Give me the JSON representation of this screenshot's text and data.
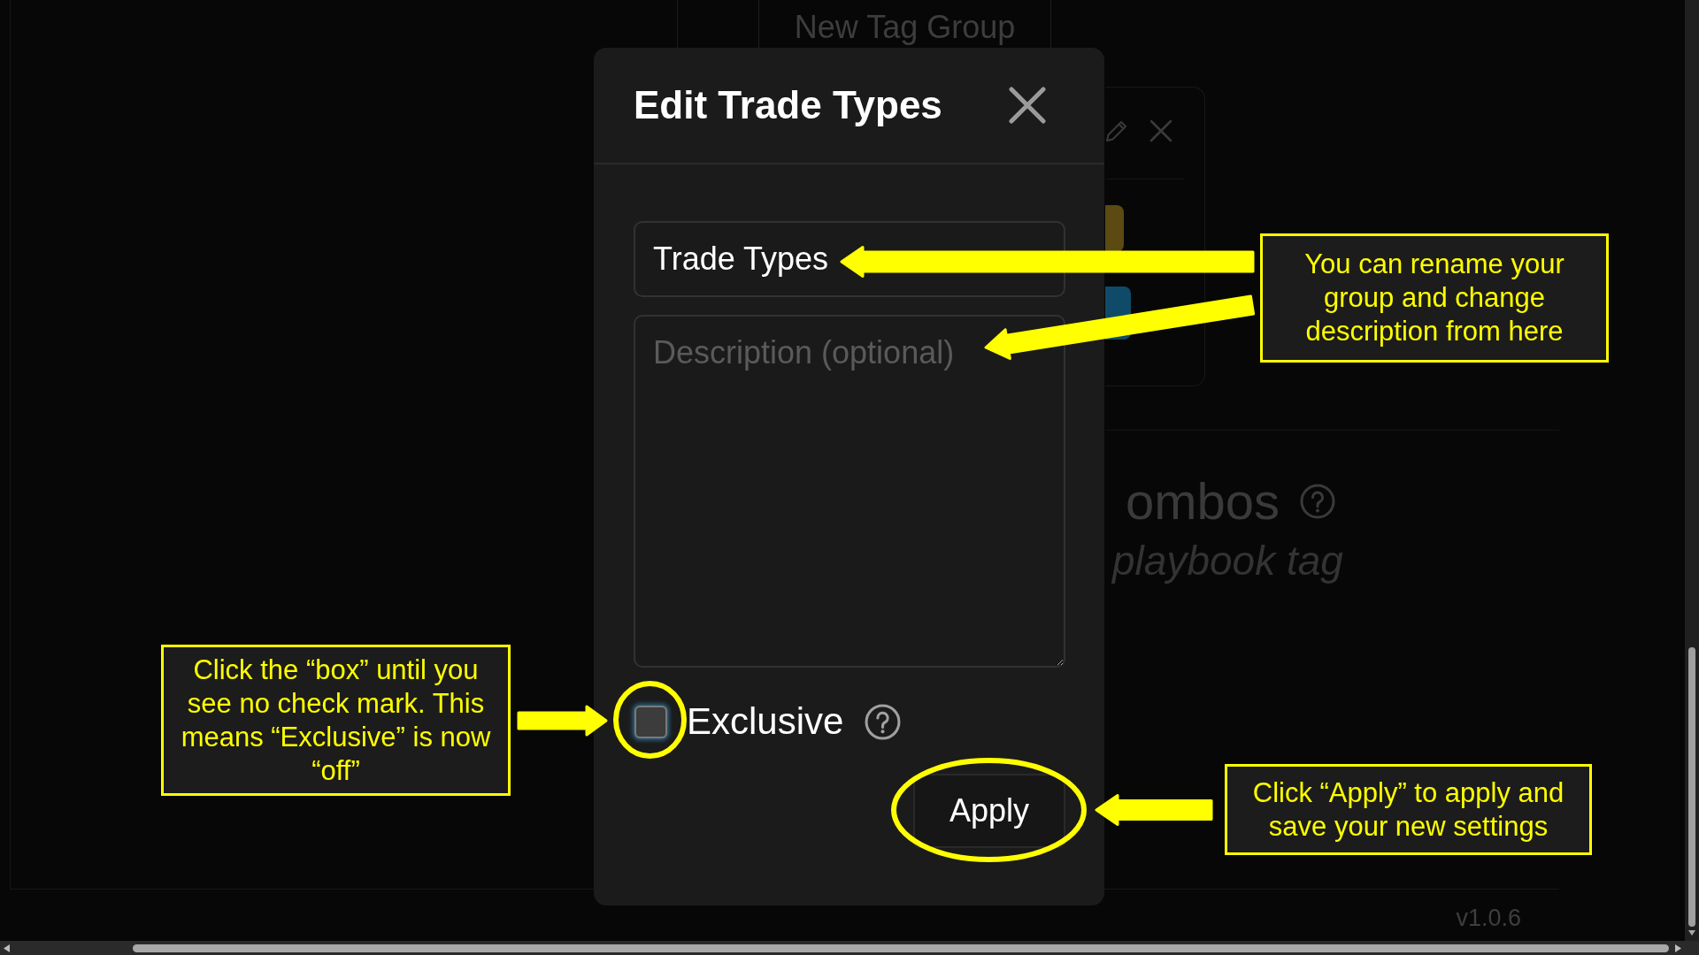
{
  "page": {
    "new_group_button": "New Tag Group",
    "tag_card": {
      "chips": [
        {
          "color": "#5b4a12"
        },
        {
          "color": "#0f4b68"
        }
      ]
    },
    "section": {
      "title": "ombos",
      "subtitle": "playbook tag"
    },
    "version": "v1.0.6"
  },
  "dialog": {
    "title": "Edit Trade Types",
    "name_field": {
      "value": "Trade Types"
    },
    "description_field": {
      "placeholder": "Description (optional)"
    },
    "exclusive": {
      "label": "Exclusive",
      "checked": false
    },
    "apply_button": "Apply"
  },
  "annotations": {
    "callouts": [
      "You can rename your group and change description from here",
      "Click the “box” until you see no check mark. This means “Exclusive” is now “off”",
      "Click “Apply” to apply and save your new settings"
    ]
  }
}
